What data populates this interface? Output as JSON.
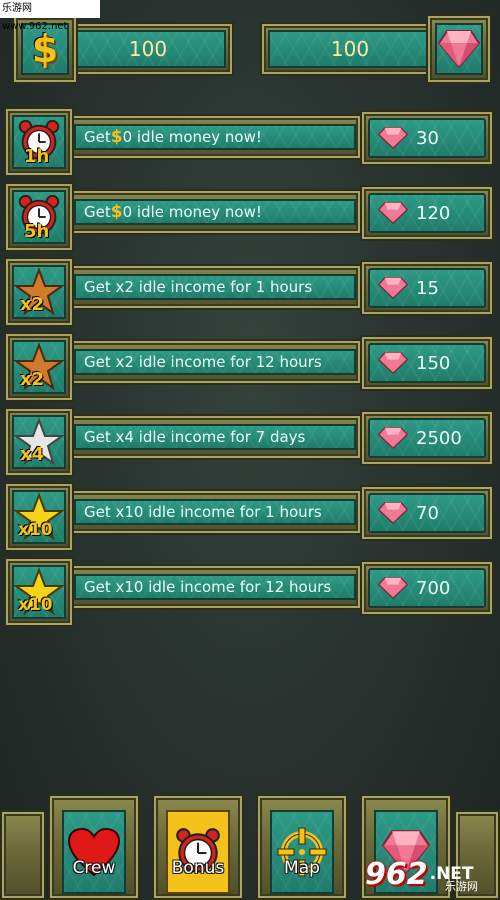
{
  "watermark": "乐游网 www.962.net",
  "top_bar": {
    "money": {
      "icon": "dollar-icon",
      "value": "100",
      "symbol": "$"
    },
    "gems": {
      "icon": "gem-icon",
      "value": "100"
    }
  },
  "offers": [
    {
      "icon": "alarm-clock-icon",
      "icon_text": "1h",
      "prefix": "Get ",
      "amount_symbol": "$",
      "suffix": "0 idle money now!",
      "price": "30"
    },
    {
      "icon": "alarm-clock-icon",
      "icon_text": "5h",
      "prefix": "Get ",
      "amount_symbol": "$",
      "suffix": "0 idle money now!",
      "price": "120"
    },
    {
      "icon": "bronze-star-icon",
      "icon_text": "x2",
      "label": "Get x2 idle income for 1 hours",
      "price": "15"
    },
    {
      "icon": "bronze-star-icon",
      "icon_text": "x2",
      "label": "Get x2 idle income for 12 hours",
      "price": "150"
    },
    {
      "icon": "silver-star-icon",
      "icon_text": "x4",
      "label": "Get x4 idle income for 7 days",
      "price": "2500"
    },
    {
      "icon": "gold-star-icon",
      "icon_text": "x10",
      "label": "Get x10 idle income for 1 hours",
      "price": "70"
    },
    {
      "icon": "gold-star-icon",
      "icon_text": "x10",
      "label": "Get x10 idle income for 12 hours",
      "price": "700"
    }
  ],
  "nav": [
    {
      "icon": "heart-icon",
      "label": "Crew"
    },
    {
      "icon": "alarm-clock-icon",
      "label": "Bonus"
    },
    {
      "icon": "crosshair-map-icon",
      "label": "Map"
    },
    {
      "icon": "gem-icon",
      "label": ""
    }
  ],
  "logo": {
    "number": "962",
    "suffix": ".NET",
    "subtitle": "乐游网"
  },
  "colors": {
    "teal": "#2d9a85",
    "olive": "#6b6a3a",
    "gem_pink": "#f07a95",
    "gold": "#f4c21a",
    "alarm_red": "#d8231c",
    "bronze": "#d07a2c",
    "silver": "#e6e6e6"
  }
}
